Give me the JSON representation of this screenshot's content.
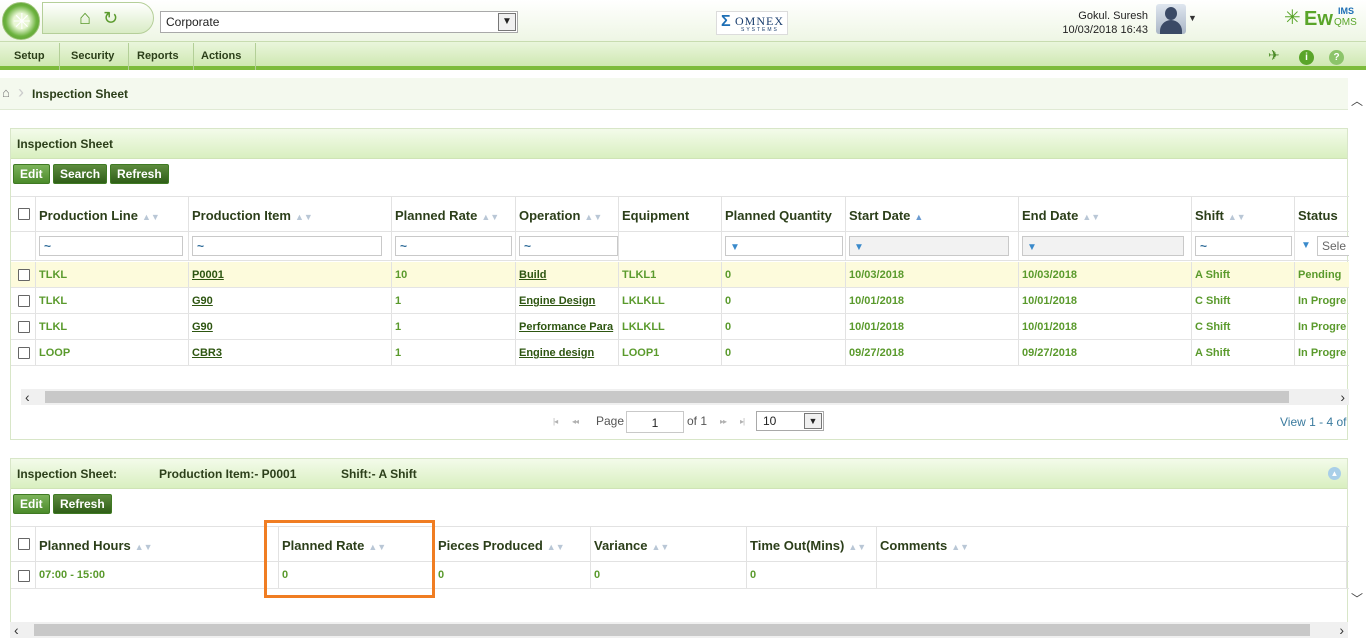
{
  "header": {
    "company_select": "Corporate",
    "brand_left": "OMNEX",
    "brand_left_sub": "SYSTEMS",
    "user_name": "Gokul. Suresh",
    "user_datetime": "10/03/2018 16:43",
    "brand_right": "Ew",
    "brand_right_ims": "IMS",
    "brand_right_qms": "QMS"
  },
  "menu": {
    "items": [
      "Setup",
      "Security",
      "Reports",
      "Actions"
    ]
  },
  "breadcrumb": {
    "current": "Inspection Sheet"
  },
  "top_panel": {
    "title": "Inspection Sheet",
    "buttons": {
      "edit": "Edit",
      "search": "Search",
      "refresh": "Refresh"
    },
    "columns": [
      "Production Line",
      "Production Item",
      "Planned Rate",
      "Operation",
      "Equipment",
      "Planned Quantity",
      "Start Date",
      "End Date",
      "Shift",
      "Status"
    ],
    "filters": {
      "tilde": "~",
      "status_select": "Sele"
    },
    "rows": [
      [
        "TLKL",
        "P0001",
        "10",
        "Build",
        "TLKL1",
        "0",
        "10/03/2018",
        "10/03/2018",
        "A Shift",
        "Pending"
      ],
      [
        "TLKL",
        "G90",
        "1",
        "Engine Design",
        "LKLKLL",
        "0",
        "10/01/2018",
        "10/01/2018",
        "C Shift",
        "In Progre"
      ],
      [
        "TLKL",
        "G90",
        "1",
        "Performance Para",
        "LKLKLL",
        "0",
        "10/01/2018",
        "10/01/2018",
        "C Shift",
        "In Progre"
      ],
      [
        "LOOP",
        "CBR3",
        "1",
        "Engine design",
        "LOOP1",
        "0",
        "09/27/2018",
        "09/27/2018",
        "A Shift",
        "In Progre"
      ]
    ],
    "pager": {
      "page_label": "Page",
      "page_value": "1",
      "of_label": "of 1",
      "page_size": "10",
      "view_text": "View 1 - 4 of"
    }
  },
  "bottom_panel": {
    "title": "Inspection Sheet:",
    "production_item": "Production Item:- P0001",
    "shift": "Shift:- A Shift",
    "buttons": {
      "edit": "Edit",
      "refresh": "Refresh"
    },
    "columns": [
      "Planned Hours",
      "Planned Rate",
      "Pieces Produced",
      "Variance",
      "Time Out(Mins)",
      "Comments"
    ],
    "rows": [
      [
        "07:00 - 15:00",
        "0",
        "0",
        "0",
        "0",
        ""
      ]
    ]
  },
  "colors": {
    "accent_green": "#5a9a2c",
    "highlight_orange": "#f07d22"
  }
}
